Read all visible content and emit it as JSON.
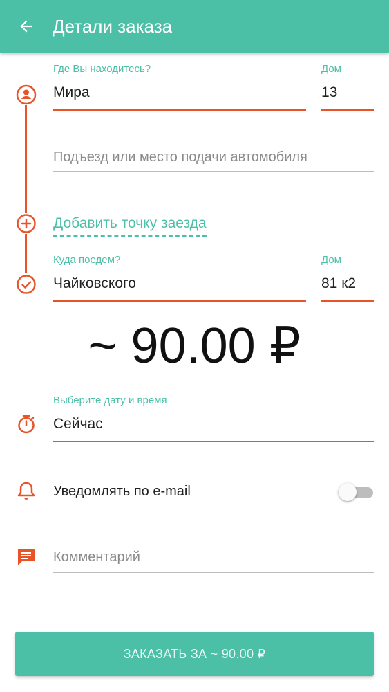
{
  "appbar": {
    "title": "Детали заказа",
    "back_icon": "arrow-left-icon"
  },
  "from": {
    "label": "Где Вы находитесь?",
    "street": "Мира",
    "house_label": "Дом",
    "house": "13"
  },
  "entrance": {
    "placeholder": "Подъезд или место подачи автомобиля"
  },
  "add_stop": {
    "label": "Добавить точку заезда"
  },
  "to": {
    "label": "Куда поедем?",
    "street": "Чайковского",
    "house_label": "Дом",
    "house": "81 к2"
  },
  "price": {
    "text": "~ 90.00 ₽"
  },
  "datetime": {
    "label": "Выберите дату и время",
    "value": "Сейчас"
  },
  "notify": {
    "label": "Уведомлять по e-mail",
    "enabled": false
  },
  "comment": {
    "placeholder": "Комментарий"
  },
  "order_button": {
    "label": "ЗАКАЗАТЬ ЗА ~ 90.00 ₽"
  },
  "colors": {
    "accent": "#4cbfa7",
    "route": "#e8542a",
    "text": "#212121"
  }
}
